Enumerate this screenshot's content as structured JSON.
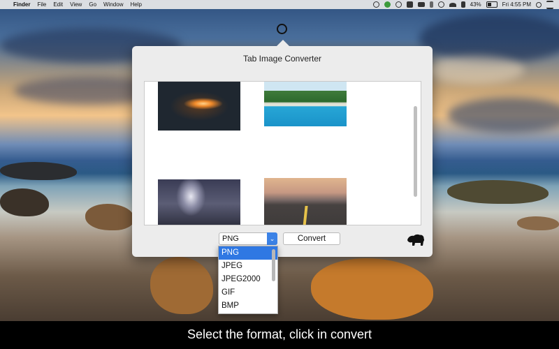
{
  "menubar": {
    "apple": "",
    "app": "Finder",
    "menus": [
      "File",
      "Edit",
      "View",
      "Go",
      "Window",
      "Help"
    ],
    "battery_percent": "43%",
    "clock": "Fri 4:55 PM",
    "icons": [
      "sync-icon",
      "chrome-icon",
      "eye-icon",
      "elephant-icon",
      "camera-icon",
      "bluetooth-icon",
      "time-machine-icon",
      "wifi-icon",
      "volume-icon",
      "battery-icon",
      "search-icon",
      "notification-center-icon"
    ]
  },
  "popover": {
    "title": "Tab Image Converter",
    "thumbnails": [
      "sparkler-icon",
      "pool-photo",
      "lightning-photo",
      "road-photo"
    ],
    "format_select": {
      "value": "PNG"
    },
    "convert_label": "Convert",
    "format_options": [
      "PNG",
      "JPEG",
      "JPEG2000",
      "GIF",
      "BMP"
    ],
    "selected_option": "PNG"
  },
  "caption": "Select the format, click in convert"
}
